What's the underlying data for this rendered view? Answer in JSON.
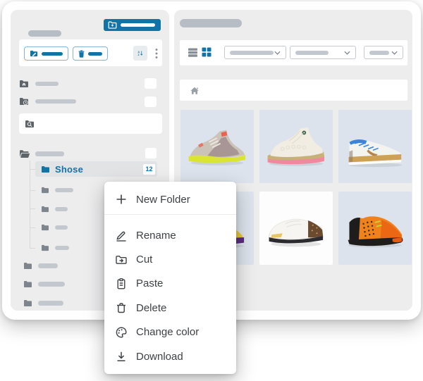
{
  "colors": {
    "primary": "#1273a7",
    "panel": "#ededee",
    "bar": "#c3c8ce",
    "bar_dark": "#b7bdc4",
    "icon_dark": "#5f6469",
    "icon_mid": "#7e858c",
    "icon_gray": "#9aa0a6",
    "row_selected": "#e2e3e5",
    "menu_text": "#3e4144",
    "border": "#c6cad0",
    "tree_line": "#d6d9dc",
    "divider": "#ececec"
  },
  "sidebar": {
    "tree": {
      "selected": {
        "label": "Shose",
        "count": "12"
      }
    },
    "search": {
      "placeholder": ""
    }
  },
  "main": {
    "grid": {
      "tiles": [
        {
          "name": "sneaker volt-gray basketball shoe",
          "bg": "#dde3ec",
          "palette": {
            "c0": "#cbc2b8",
            "c1": "#a18e8e",
            "c2": "#d9e434",
            "c3": "#e86350",
            "c4": "#ece7e0"
          }
        },
        {
          "name": "sneaker white-tan hightop with pink sole",
          "bg": "#dde3ec",
          "palette": {
            "c0": "#f1ede2",
            "c1": "#c8b176",
            "c2": "#f287a0",
            "c3": "#44694a",
            "c4": "#e6dfcf"
          }
        },
        {
          "name": "sneaker white trainer blue laces gum sole",
          "bg": "#dde3ec",
          "palette": {
            "c0": "#f3f3f0",
            "c1": "#3a84d9",
            "c2": "#cfa058",
            "c3": "#b5854b"
          }
        },
        {
          "name": "sneaker yellow-purple",
          "bg": "#dde3ec",
          "palette": {
            "c0": "#e9c73b",
            "c1": "#5a2d82",
            "c2": "#f3f3f3"
          }
        },
        {
          "name": "sneaker white runner with brown monogram heel",
          "bg": "#fdfdfd",
          "palette": {
            "c0": "#f6f5f1",
            "c1": "#6b4a2f",
            "c2": "#e7c568",
            "c3": "#2c2c30",
            "c4": "#caa96d"
          }
        },
        {
          "name": "sneaker orange-black runner",
          "bg": "#dde3ec",
          "palette": {
            "c0": "#f0821c",
            "c1": "#1f1d1c",
            "c2": "#c6d832",
            "c3": "#e8590f"
          }
        }
      ]
    }
  },
  "context_menu": {
    "items": [
      {
        "id": "new-folder",
        "label": "New Folder"
      },
      {
        "id": "rename",
        "label": "Rename"
      },
      {
        "id": "cut",
        "label": "Cut"
      },
      {
        "id": "paste",
        "label": "Paste"
      },
      {
        "id": "delete",
        "label": "Delete"
      },
      {
        "id": "change-color",
        "label": "Change color"
      },
      {
        "id": "download",
        "label": "Download"
      }
    ]
  }
}
